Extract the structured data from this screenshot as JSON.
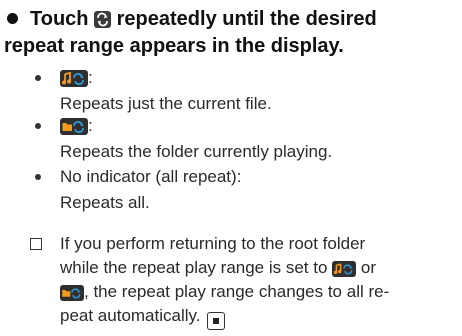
{
  "instruction": {
    "touch_word": "Touch",
    "rest_line1": "repeatedly until the desired",
    "line2": "repeat range appears in the display."
  },
  "options": [
    {
      "icon": "repeat-current-file-icon",
      "label_suffix": ":",
      "description": "Repeats just the current file."
    },
    {
      "icon": "repeat-folder-icon",
      "label_suffix": ":",
      "description": "Repeats the folder currently playing."
    },
    {
      "label": "No indicator (all repeat):",
      "description": "Repeats all."
    }
  ],
  "note": {
    "line1": "If you perform returning to the root folder",
    "line2_prefix": "while the repeat play range is set to",
    "line2_suffix": "or",
    "line3_suffix": ", the repeat play range changes to all re-",
    "line4": "peat automatically."
  },
  "colors": {
    "text": "#2a2a2a",
    "icon_orange": "#f39a1f",
    "icon_blue": "#2f9ad8",
    "icon_bg": "#2f2f2f"
  }
}
